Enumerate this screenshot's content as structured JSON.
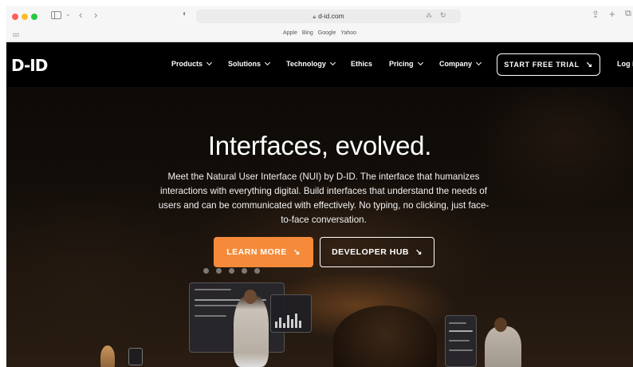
{
  "browser": {
    "url": "d-id.com",
    "favorites": [
      "Apple",
      "Bing",
      "Google",
      "Yahoo"
    ]
  },
  "nav": {
    "logo": "D-ID",
    "items": [
      {
        "label": "Products",
        "dropdown": true
      },
      {
        "label": "Solutions",
        "dropdown": true
      },
      {
        "label": "Technology",
        "dropdown": true
      },
      {
        "label": "Ethics",
        "dropdown": false
      },
      {
        "label": "Pricing",
        "dropdown": true
      },
      {
        "label": "Company",
        "dropdown": true
      }
    ],
    "cta": "START FREE TRIAL",
    "login": "Log i"
  },
  "hero": {
    "title": "Interfaces, evolved.",
    "description": "Meet the Natural User Interface (NUI) by D-ID. The interface that humanizes interactions with everything digital. Build interfaces that understand the needs of users and can be communicated with effectively. No typing, no clicking, just face-to-face conversation.",
    "primary_button": "LEARN MORE",
    "secondary_button": "DEVELOPER HUB"
  },
  "colors": {
    "accent": "#f58b3a",
    "nav_bg": "#000000",
    "text": "#ffffff"
  },
  "icons": [
    "sidebar-icon",
    "back-icon",
    "forward-icon",
    "shield-icon",
    "translate-icon",
    "reload-icon",
    "share-icon",
    "new-tab-icon",
    "tabs-icon",
    "grid-icon",
    "arrow-down-right-icon"
  ]
}
